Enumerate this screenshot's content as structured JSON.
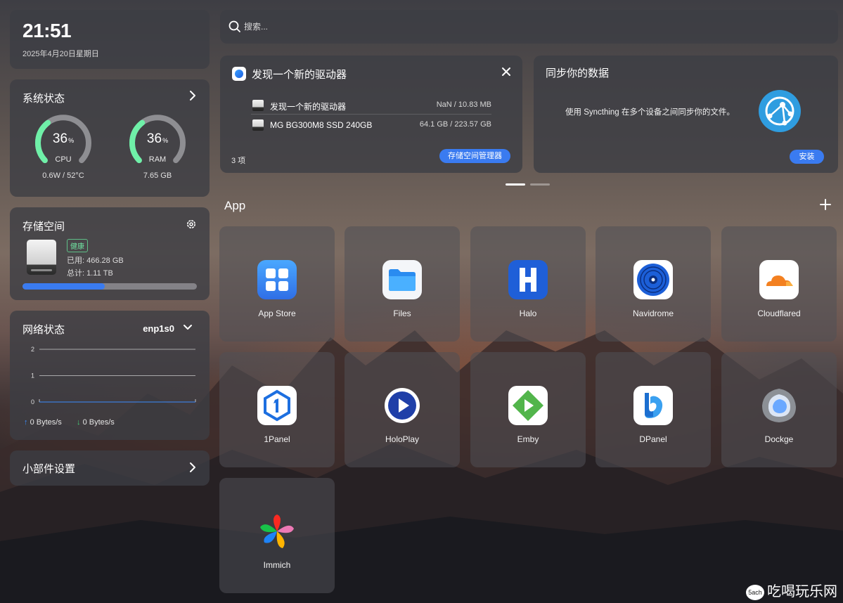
{
  "clock": {
    "time": "21:51",
    "date": "2025年4月20日星期日"
  },
  "system": {
    "title": "系统状态",
    "cpu": {
      "percent": 36,
      "unit": "%",
      "label": "CPU",
      "sub": "0.6W / 52°C"
    },
    "ram": {
      "percent": 36,
      "unit": "%",
      "label": "RAM",
      "sub": "7.65 GB"
    }
  },
  "storage": {
    "title": "存储空间",
    "badge": "健康",
    "used": "已用: 466.28 GB",
    "total": "总计: 1.11 TB",
    "fill_fraction": 0.47
  },
  "network": {
    "title": "网络状态",
    "interface": "enp1s0",
    "chart_data": {
      "type": "line",
      "y_ticks": [
        "2",
        "1",
        "0"
      ],
      "ylim": [
        0,
        2
      ],
      "series": [
        {
          "values": [
            0,
            0,
            0,
            0,
            0,
            0,
            0,
            0,
            0,
            0
          ]
        }
      ]
    },
    "upload": "0 Bytes/s",
    "download": "0 Bytes/s",
    "colors": {
      "up": "#3a8cff",
      "down": "#44d07a"
    }
  },
  "widgets": {
    "title": "小部件设置"
  },
  "search": {
    "placeholder": "搜索..."
  },
  "drive_card": {
    "title": "发现一个新的驱动器",
    "rows": [
      {
        "name": "发现一个新的驱动器",
        "size": "NaN / 10.83 MB"
      },
      {
        "name": "MG BG300M8 SSD 240GB",
        "size": "64.1 GB / 223.57 GB"
      }
    ],
    "count": "3 项",
    "button": "存储空间管理器"
  },
  "sync_card": {
    "title": "同步你的数据",
    "desc": "使用 Syncthing 在多个设备之间同步你的文件。",
    "button": "安装"
  },
  "apps": {
    "title": "App",
    "items": [
      {
        "label": "App Store",
        "icon": "app-store-icon"
      },
      {
        "label": "Files",
        "icon": "folder-icon"
      },
      {
        "label": "Halo",
        "icon": "halo-icon"
      },
      {
        "label": "Navidrome",
        "icon": "vinyl-icon"
      },
      {
        "label": "Cloudflared",
        "icon": "cloud-icon"
      },
      {
        "label": "1Panel",
        "icon": "onepanel-icon"
      },
      {
        "label": "HoloPlay",
        "icon": "play-icon"
      },
      {
        "label": "Emby",
        "icon": "emby-icon"
      },
      {
        "label": "DPanel",
        "icon": "whale-icon"
      },
      {
        "label": "Dockge",
        "icon": "dockge-icon"
      },
      {
        "label": "Immich",
        "icon": "pinwheel-icon"
      }
    ]
  },
  "watermark": {
    "badge": "5ach",
    "text": "吃喝玩乐网"
  },
  "colors": {
    "accent": "#3a7bf0",
    "gauge": "#6ff0a8",
    "healthy": "#6fe0a0"
  }
}
